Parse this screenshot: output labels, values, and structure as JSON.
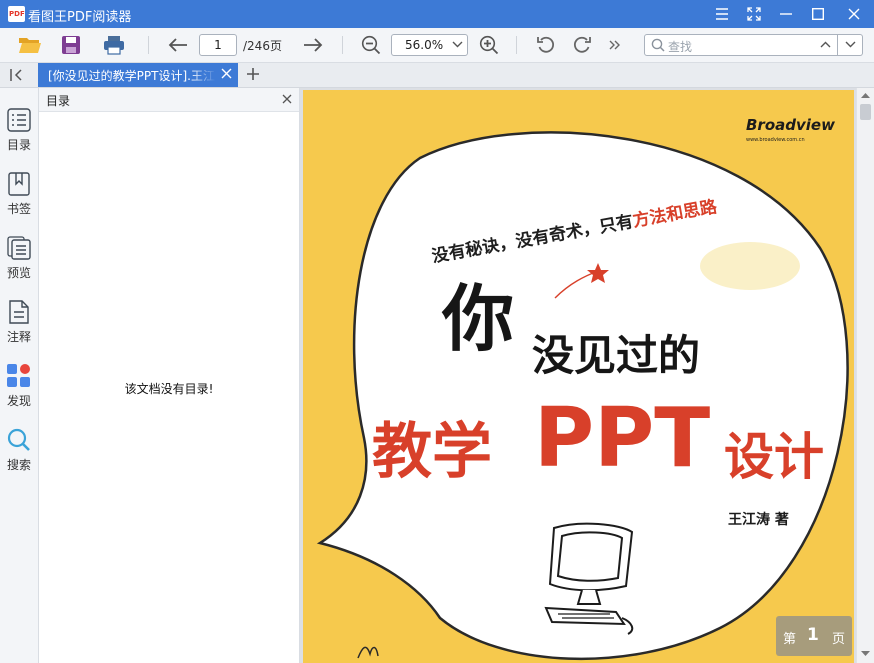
{
  "window": {
    "title": "看图王PDF阅读器",
    "logo_text": "PDF"
  },
  "toolbar": {
    "page_current": "1",
    "page_total": "/246页",
    "zoom": "56.0%",
    "search_placeholder": "查找"
  },
  "tabs": [
    {
      "label": "[你没见过的教学PPT设计].王江涛"
    }
  ],
  "sidebar": {
    "items": [
      {
        "label": "目录",
        "icon": "list-icon"
      },
      {
        "label": "书签",
        "icon": "bookmark-icon"
      },
      {
        "label": "预览",
        "icon": "preview-icon"
      },
      {
        "label": "注释",
        "icon": "annotation-icon"
      },
      {
        "label": "发现",
        "icon": "discover-icon"
      },
      {
        "label": "搜索",
        "icon": "search-icon"
      }
    ]
  },
  "outline": {
    "title": "目录",
    "empty_message": "该文档没有目录!"
  },
  "cover": {
    "publisher": "Broadview",
    "publisher_url": "www.broadview.com.cn",
    "slogan_part1": "没有秘诀，没有奇术，只有",
    "slogan_part2": "方法和思路",
    "title_part1": "你",
    "title_part2": "没见过的",
    "title_part3": "教学",
    "title_part4": "PPT",
    "title_part5": "设计",
    "author": "王江涛 著"
  },
  "page_indicator": {
    "prefix": "第",
    "number": "1",
    "suffix": "页"
  },
  "colors": {
    "accent": "#3d7ad6",
    "cover_bg": "#f6c94d",
    "cover_red": "#d8402a"
  }
}
